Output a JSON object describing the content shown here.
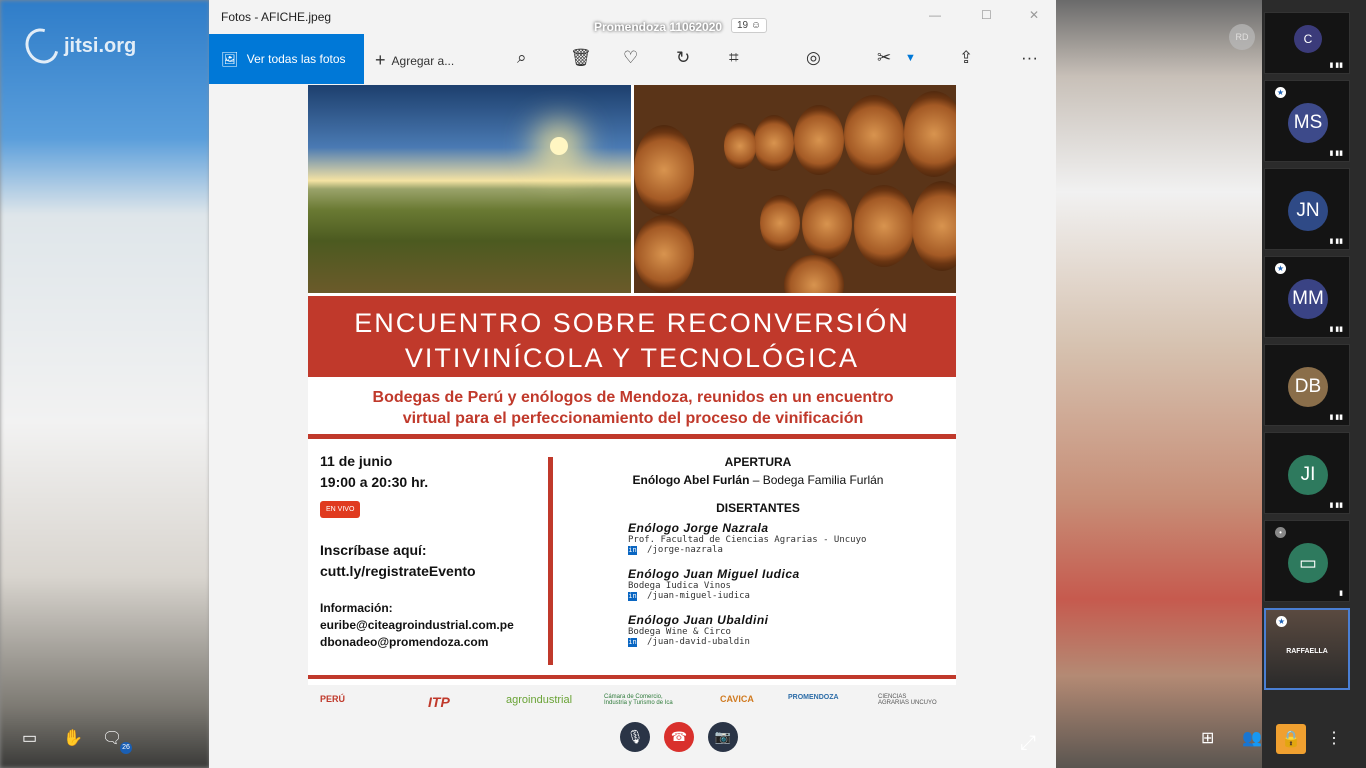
{
  "jitsi": {
    "logo_text": "jitsi.org",
    "meeting_title": "Promendoza 11062020",
    "participant_count": "19",
    "moderator_initials": "RD"
  },
  "photos": {
    "app_title": "Fotos - AFICHE.jpeg",
    "see_all_label": "Ver todas las fotos",
    "add_label": "Agregar a...",
    "more_label": "···"
  },
  "poster": {
    "title_line1": "ENCUENTRO SOBRE RECONVERSIÓN",
    "title_line2": "VITIVINÍCOLA Y TECNOLÓGICA",
    "subtitle_line1": "Bodegas de Perú y enólogos de Mendoza, reunidos en un encuentro",
    "subtitle_line2": "virtual para el perfeccionamiento del proceso de vinificación",
    "date": "11 de junio",
    "time": "19:00 a 20:30 hr.",
    "live_badge": "EN VIVO",
    "register_label": "Inscríbase aquí:",
    "register_url": "cutt.ly/registrateEvento",
    "info_label": "Información:",
    "email1": "euribe@citeagroindustrial.com.pe",
    "email2": "dbonadeo@promendoza.com",
    "opening_heading": "APERTURA",
    "opening_name": "Enólogo Abel Furlán",
    "opening_org": " – Bodega Familia Furlán",
    "speakers_heading": "DISERTANTES",
    "speakers": [
      {
        "name": "Enólogo Jorge Nazrala",
        "org": "Prof. Facultad de Ciencias Agrarias - Uncuyo",
        "linkedin": "/jorge-nazrala"
      },
      {
        "name": "Enólogo Juan Miguel Iudica",
        "org": "Bodega Iudica Vinos",
        "linkedin": "/juan-miguel-iudica"
      },
      {
        "name": "Enólogo Juan Ubaldini",
        "org": "Bodega Wine & Circo",
        "linkedin": "/juan-david-ubaldin"
      }
    ],
    "logos": [
      "PERÚ",
      "ITP",
      "agroindustrial",
      "Cámara de Comercio, Industria y Turismo de Ica",
      "CAVICA",
      "PROMENDOZA",
      "CIENCIAS AGRARIAS UNCUYO"
    ]
  },
  "participants": [
    {
      "initials": "C",
      "color": "#3b3b7a"
    },
    {
      "initials": "MS",
      "color": "#3d4a8a"
    },
    {
      "initials": "JN",
      "color": "#2f4a86"
    },
    {
      "initials": "MM",
      "color": "#3a4384"
    },
    {
      "initials": "DB",
      "color": "#8a6e4a"
    },
    {
      "initials": "JI",
      "color": "#2e7a5e"
    },
    {
      "initials": "",
      "color": "#2e7a5e"
    },
    {
      "initials": "RAFFAELLA",
      "color": "#3a3a3a"
    }
  ],
  "bottom": {
    "chat_badge": "26"
  }
}
